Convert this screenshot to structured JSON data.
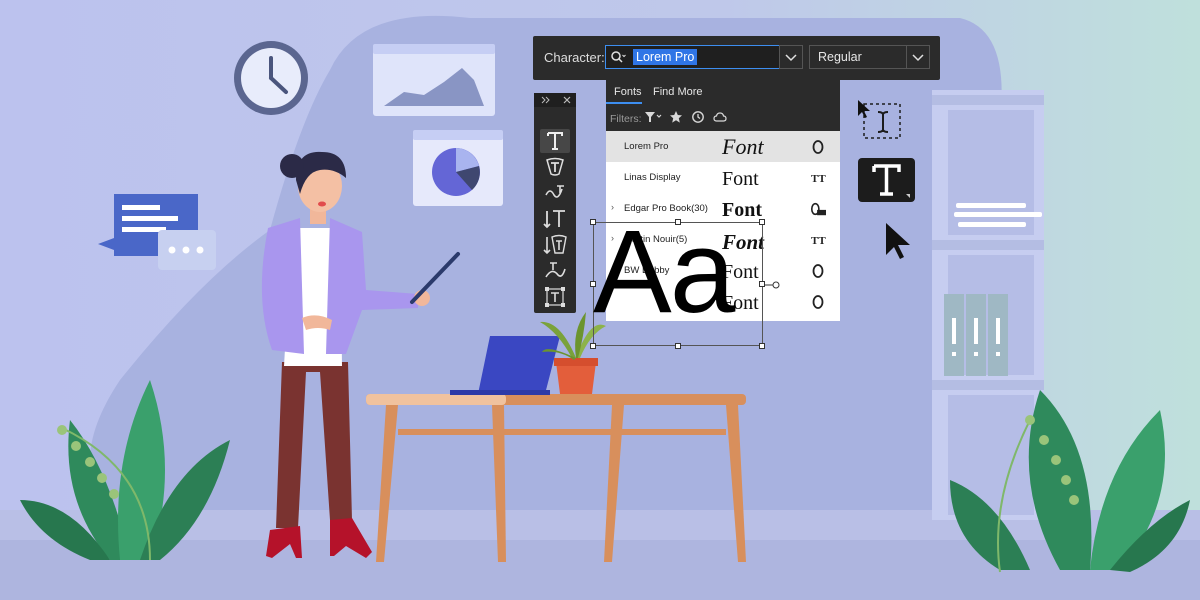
{
  "character_panel": {
    "label": "Character:",
    "search_value": "Lorem Pro",
    "style_value": "Regular",
    "tabs": [
      "Fonts",
      "Find More"
    ],
    "filters_label": "Filters:"
  },
  "font_list": [
    {
      "name": "Lorem Pro",
      "sample": "Font",
      "type_icon": "opentype-icon",
      "selected": true
    },
    {
      "name": "Linas Display",
      "sample": "Font",
      "type_icon": "truetype-icon"
    },
    {
      "name": "Edgar Pro Book(30)",
      "sample": "Font",
      "type_icon": "variable-font-icon",
      "expandable": true
    },
    {
      "name": "Martin Nouir(5)",
      "sample": "Font",
      "type_icon": "truetype-icon",
      "expandable": true
    },
    {
      "name": "BW Dabby",
      "sample": "Font",
      "type_icon": "opentype-icon"
    },
    {
      "name": "",
      "sample": "Font",
      "type_icon": "opentype-icon"
    }
  ],
  "tools": [
    "type-tool-icon",
    "type-on-path-icon",
    "warp-text-icon",
    "vertical-type-icon",
    "vertical-area-type-icon",
    "touch-type-icon",
    "area-type-icon"
  ],
  "canvas_text": "Aa",
  "colors": {
    "background": "#c2c9ec",
    "panel_dark": "#2b2b2b",
    "accent": "#2f75e6",
    "plant_green": "#2f8a5c",
    "desk": "#d88f5c"
  }
}
